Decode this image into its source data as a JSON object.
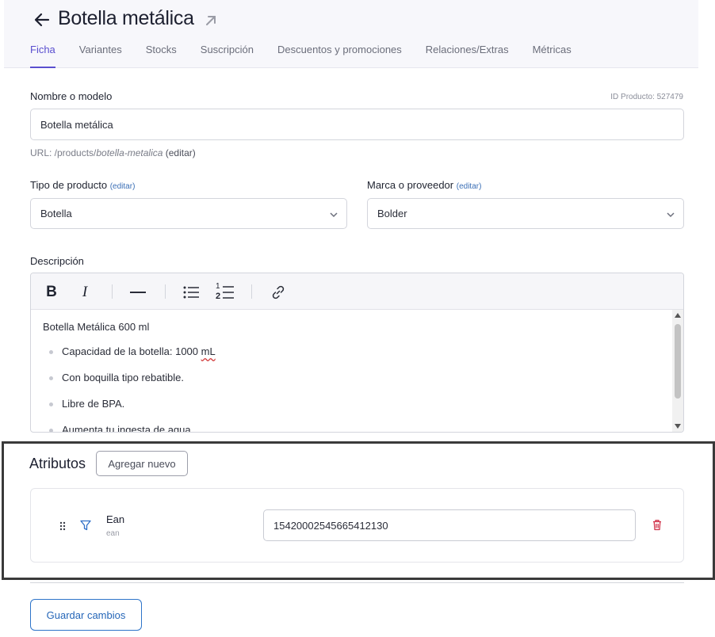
{
  "header": {
    "title": "Botella metálica",
    "tabs": [
      {
        "label": "Ficha",
        "active": true
      },
      {
        "label": "Variantes",
        "active": false
      },
      {
        "label": "Stocks",
        "active": false
      },
      {
        "label": "Suscripción",
        "active": false
      },
      {
        "label": "Descuentos y promociones",
        "active": false
      },
      {
        "label": "Relaciones/Extras",
        "active": false
      },
      {
        "label": "Métricas",
        "active": false
      }
    ]
  },
  "form": {
    "name_label": "Nombre o modelo",
    "product_id_label": "ID Producto: 527479",
    "name_value": "Botella metálica",
    "url_prefix": "URL: /products/",
    "url_slug": "botella-metalica",
    "url_edit": " (editar)",
    "type_label": "Tipo de producto",
    "type_edit": "(editar)",
    "type_value": "Botella",
    "brand_label": "Marca o proveedor",
    "brand_edit": "(editar)",
    "brand_value": "Bolder",
    "description_label": "Descripción"
  },
  "editor": {
    "toolbar": {
      "bold": "B",
      "italic": "I",
      "list_numbered_top": "1",
      "list_numbered_bottom": "2"
    },
    "content": {
      "heading": "Botella Metálica 600 ml",
      "item1_prefix": "Capacidad de la botella: 1000 ",
      "item1_unit": "mL",
      "item2": "Con boquilla tipo rebatible.",
      "item3": "Libre de BPA.",
      "item4": "Aumenta tu ingesta de agua."
    }
  },
  "attributes": {
    "title": "Atributos",
    "add_label": "Agregar nuevo",
    "items": [
      {
        "name": "Ean",
        "key": "ean",
        "value": "15420002545665412130"
      }
    ]
  },
  "footer": {
    "save_label": "Guardar cambios"
  },
  "colors": {
    "accent": "#5a4fcf",
    "link": "#3b6fb6",
    "primary_button": "#2566b8",
    "danger": "#d0334a",
    "filter_icon": "#2f6fc7"
  }
}
